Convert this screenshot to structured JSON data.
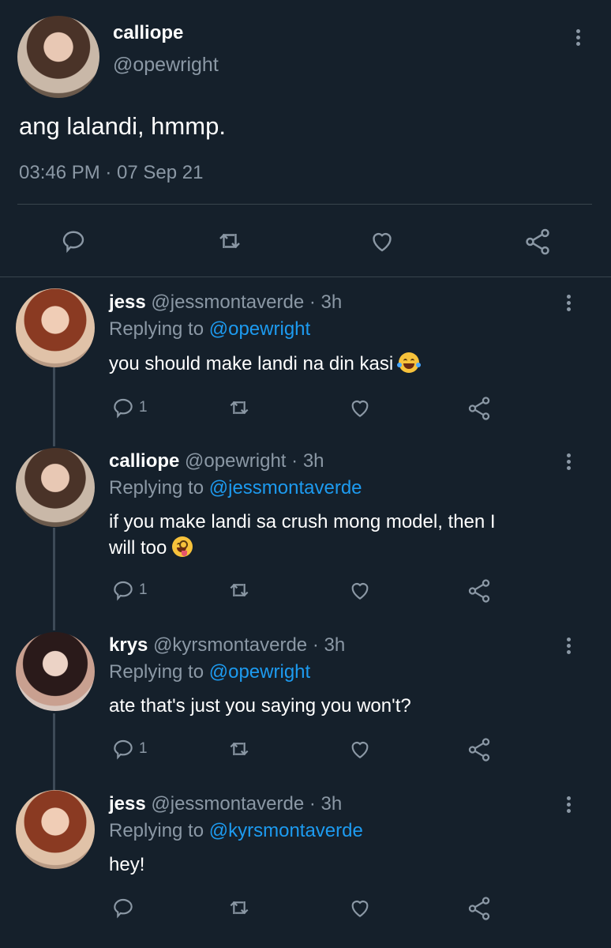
{
  "main_tweet": {
    "name": "calliope",
    "handle": "@opewright",
    "text": "ang lalandi, hmmp.",
    "timestamp": "03:46 PM · 07 Sep 21"
  },
  "replies": [
    {
      "name": "jess",
      "handle": "@jessmontaverde",
      "time": "· 3h",
      "replying_label": "Replying to",
      "replying_to": "@opewright",
      "text": "you should make landi na din kasi",
      "emoji": "face-with-tears-of-joy",
      "reply_count": "1"
    },
    {
      "name": "calliope",
      "handle": "@opewright",
      "time": "· 3h",
      "replying_label": "Replying to",
      "replying_to": "@jessmontaverde",
      "text_line1": "if you make landi sa crush mong model, then I",
      "text_line2": "will too",
      "emoji": "zany-face",
      "reply_count": "1"
    },
    {
      "name": "krys",
      "handle": "@kyrsmontaverde",
      "time": "· 3h",
      "replying_label": "Replying to",
      "replying_to": "@opewright",
      "text": "ate that's just you saying you won't?",
      "reply_count": "1"
    },
    {
      "name": "jess",
      "handle": "@jessmontaverde",
      "time": "· 3h",
      "replying_label": "Replying to",
      "replying_to": "@kyrsmontaverde",
      "text": "hey!",
      "reply_count": ""
    }
  ],
  "colors": {
    "background": "#15202b",
    "muted": "#8b98a5",
    "link": "#1d9bf0",
    "thread_line": "#3d4a57"
  }
}
